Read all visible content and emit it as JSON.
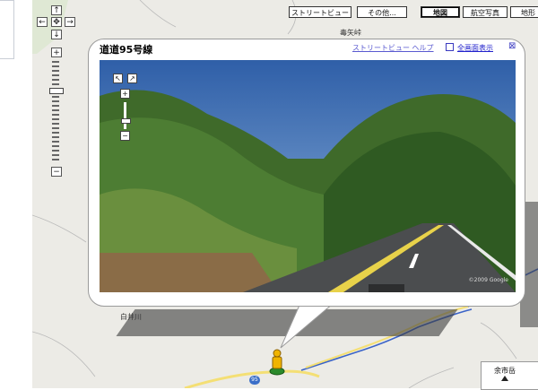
{
  "nav": {
    "pan_up": "↑",
    "pan_left": "←",
    "pan_center": "✥",
    "pan_right": "→",
    "pan_down": "↓",
    "zoom_in": "+",
    "zoom_out": "−"
  },
  "map_types": {
    "streetview": "ストリートビュー",
    "other": "その他...",
    "map": "地図",
    "satellite": "航空写真",
    "terrain": "地形"
  },
  "places": {
    "mountain": "毒矢峠",
    "river": "白井川",
    "route": "95",
    "station": "余市岳"
  },
  "infowindow": {
    "title": "道道95号線",
    "help_link": "ストリートビュー ヘルプ",
    "fullscreen_link": "全画面表示",
    "close_symbol": "⊠"
  },
  "streetview": {
    "pan_left": "↖",
    "pan_right": "↗",
    "zoom_in": "+",
    "zoom_out": "−",
    "copyright": "©2009 Google"
  },
  "colors": {
    "map_bg": "#ecebe6",
    "road": "#f4df74",
    "river": "#3a63c8"
  }
}
